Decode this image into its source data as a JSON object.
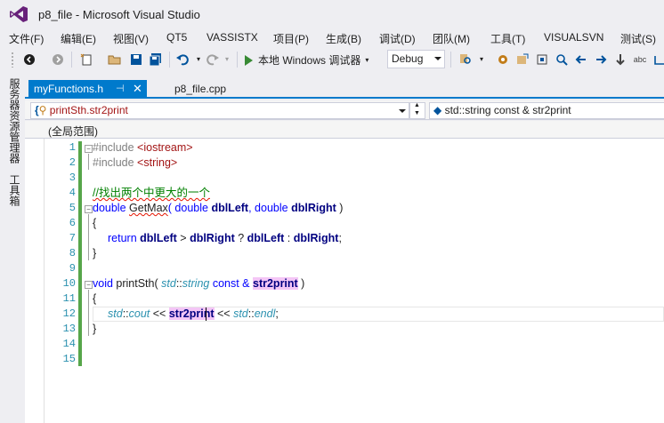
{
  "window": {
    "title": "p8_file - Microsoft Visual Studio"
  },
  "menu": [
    "文件(F)",
    "编辑(E)",
    "视图(V)",
    "QT5",
    "VASSISTX",
    "项目(P)",
    "生成(B)",
    "调试(D)",
    "团队(M)",
    "工具(T)",
    "VISUALSVN",
    "测试(S)"
  ],
  "toolbar": {
    "run_label": "本地 Windows 调试器",
    "config": "Debug"
  },
  "sidebar": {
    "tab1": "服务器资源管理器",
    "tab2": "工具箱"
  },
  "tabs": {
    "active": "myFunctions.h",
    "pin_icon": "pin-icon",
    "inactive": "p8_file.cpp"
  },
  "nav": {
    "left": "printSth.str2print",
    "right": "std::string const & str2print"
  },
  "scope": "(全局范围)",
  "line_numbers": [
    "1",
    "2",
    "3",
    "4",
    "5",
    "6",
    "7",
    "8",
    "9",
    "10",
    "11",
    "12",
    "13",
    "14",
    "15"
  ],
  "code": {
    "l1_a": "#include ",
    "l1_b": "<iostream>",
    "l2_a": "#include ",
    "l2_b": "<string>",
    "l4": "//找出两个中更大的一个",
    "l5_kw": "double ",
    "l5_fn": "GetMax",
    "l5_a": "( double ",
    "l5_p1": "dblLeft",
    "l5_b": ", double ",
    "l5_p2": "dblRight",
    "l5_c": " )",
    "l6": "{",
    "l7_kw": "return ",
    "l7_p1": "dblLeft",
    "l7_a": " > ",
    "l7_p2": "dblRight",
    "l7_b": " ? ",
    "l7_p3": "dblLeft",
    "l7_c": " : ",
    "l7_p4": "dblRight",
    "l7_d": ";",
    "l8": "}",
    "l10_kw": "void ",
    "l10_fn": "printSth",
    "l10_a": "( ",
    "l10_ns": "std",
    "l10_b": "::",
    "l10_ty": "string",
    "l10_c": " const & ",
    "l10_p": "str2print",
    "l10_d": " )",
    "l11": "{",
    "l12_ns": "std",
    "l12_a": "::",
    "l12_cout": "cout",
    "l12_b": " << ",
    "l12_p": "str2print",
    "l12_c": " << ",
    "l12_ns2": "std",
    "l12_d": "::",
    "l12_endl": "endl",
    "l12_e": ";",
    "l13": "}"
  }
}
